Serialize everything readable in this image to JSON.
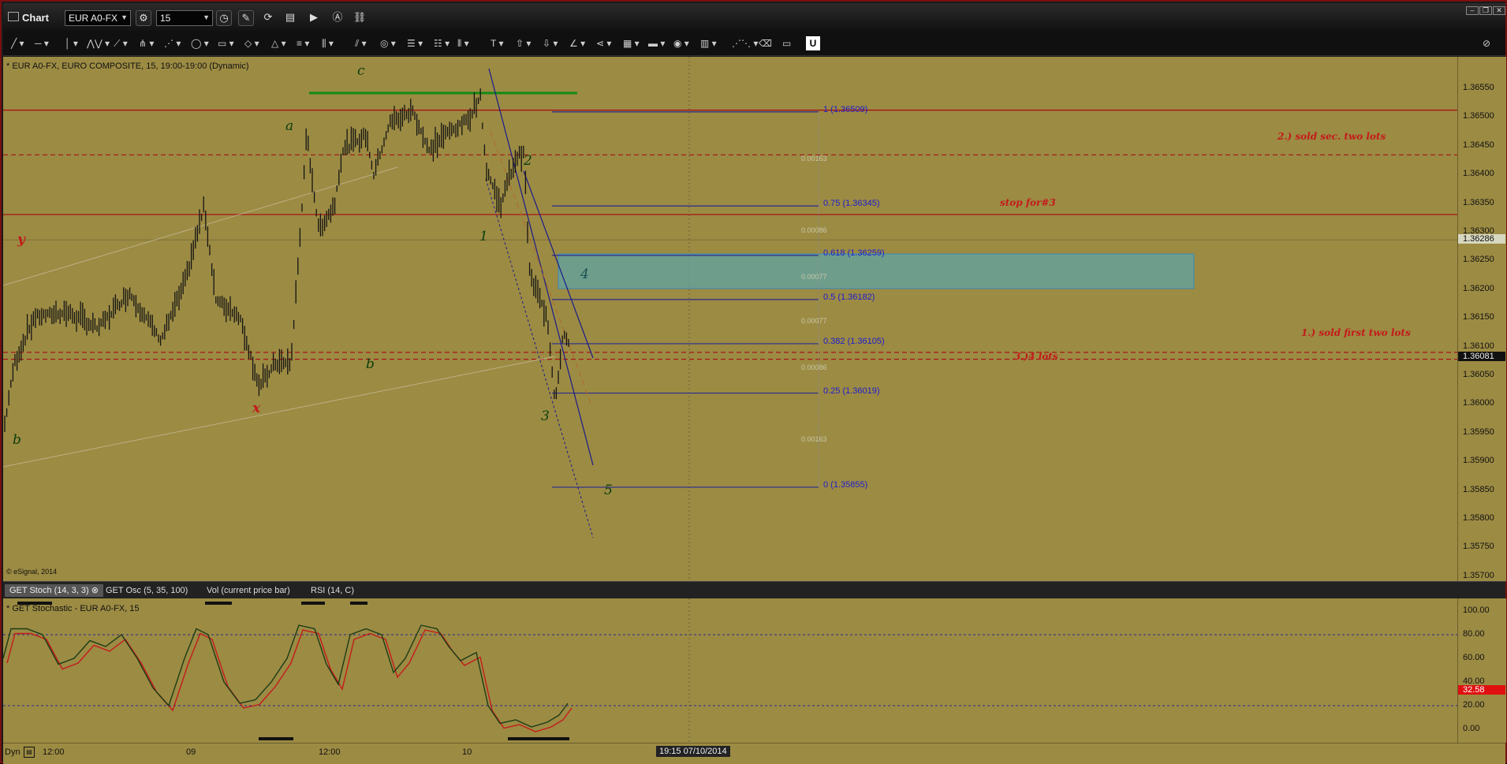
{
  "window": {
    "title": "Chart",
    "symbol": "EUR A0-FX",
    "interval": "15"
  },
  "chart_header": "* EUR A0-FX, EURO COMPOSITE, 15, 19:00-19:00 (Dynamic)",
  "copyright": "© eSignal, 2014",
  "price_axis": {
    "labels": [
      "1.36550",
      "1.36500",
      "1.36450",
      "1.36400",
      "1.36350",
      "1.36300",
      "1.36250",
      "1.36200",
      "1.36150",
      "1.36100",
      "1.36050",
      "1.36000",
      "1.35950",
      "1.35900",
      "1.35850",
      "1.35800",
      "1.35750",
      "1.35700"
    ],
    "marker_price": "1.36286",
    "marker_last": "1.36081"
  },
  "fib_levels": [
    {
      "label": "1 (1.36509)",
      "price": 1.36509
    },
    {
      "label": "0.75 (1.36345)",
      "price": 1.36345
    },
    {
      "label": "0.618 (1.36259)",
      "price": 1.36259
    },
    {
      "label": "0.5 (1.36182)",
      "price": 1.36182
    },
    {
      "label": "0.382 (1.36105)",
      "price": 1.36105
    },
    {
      "label": "0.25 (1.36019)",
      "price": 1.36019
    },
    {
      "label": "0 (1.35855)",
      "price": 1.35855
    }
  ],
  "fib_diffs": [
    "0.00163",
    "0.00086",
    "0.00077",
    "0.00077",
    "0.00086",
    "0.00163"
  ],
  "wave_labels": {
    "c": "c",
    "a": "a",
    "b_mid": "b",
    "b_left": "b",
    "y": "y",
    "x": "x",
    "w1": "1",
    "w2": "2",
    "w3": "3",
    "w4": "4",
    "w5": "5"
  },
  "notes": {
    "sold_sec": "2.) sold sec. two lots",
    "stop": "stop for#3",
    "sold_first": "1.) sold first two lots",
    "lots": "3.)4 lots"
  },
  "tabs": [
    {
      "label": "GET Stoch (14, 3, 3)",
      "close": "⊗"
    },
    {
      "label": "GET Osc (5, 35, 100)"
    },
    {
      "label": "Vol (current price bar)"
    },
    {
      "label": "RSI (14, C)"
    }
  ],
  "stoch_header": "* GET Stochastic - EUR A0-FX, 15",
  "stoch_axis": {
    "labels": [
      "100.00",
      "80.00",
      "60.00",
      "40.00",
      "20.00",
      "0.00"
    ],
    "marker": "32.58"
  },
  "time_axis": {
    "mode": "Dyn",
    "labels": [
      "12:00",
      "09",
      "12:00",
      "10",
      "19:15 07/10/2014"
    ]
  },
  "colors": {
    "background": "#9c8b43",
    "fib": "#1c1cd0",
    "notes": "#c31a1a",
    "waves_green": "#0b3d0b",
    "waves_red": "#c31a1a",
    "zone": "#5fa3a3"
  }
}
